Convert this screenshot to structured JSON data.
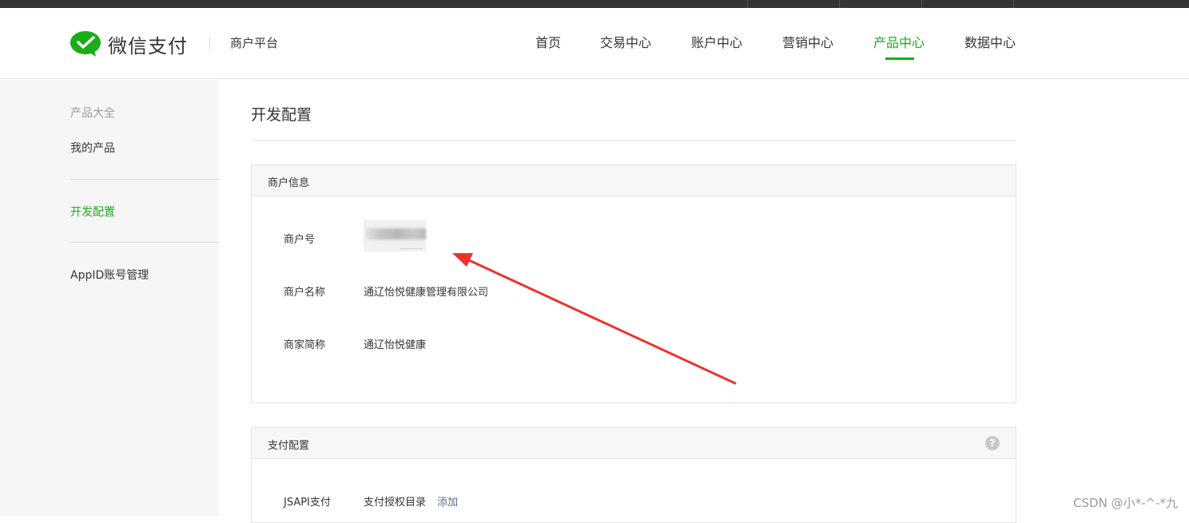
{
  "brand": {
    "name": "微信支付",
    "platform": "商户平台"
  },
  "nav": {
    "items": [
      {
        "label": "首页"
      },
      {
        "label": "交易中心"
      },
      {
        "label": "账户中心"
      },
      {
        "label": "营销中心"
      },
      {
        "label": "产品中心",
        "active": true
      },
      {
        "label": "数据中心"
      }
    ]
  },
  "sidebar": {
    "items": [
      {
        "label": "产品大全"
      },
      {
        "label": "我的产品"
      },
      {
        "label": "开发配置",
        "active": true
      },
      {
        "label": "AppID账号管理"
      }
    ]
  },
  "main": {
    "title": "开发配置",
    "merchant_panel": {
      "title": "商户信息",
      "rows": [
        {
          "label": "商户号",
          "value": ""
        },
        {
          "label": "商户名称",
          "value": "通辽怡悦健康管理有限公司"
        },
        {
          "label": "商家简称",
          "value": "通辽怡悦健康"
        }
      ]
    },
    "pay_panel": {
      "title": "支付配置",
      "help_icon": "question-icon",
      "row": {
        "label": "JSAPI支付",
        "value": "支付授权目录",
        "action": "添加"
      }
    }
  },
  "watermark": "CSDN @小*-^-*九",
  "colors": {
    "accent": "#1aad19",
    "link": "#576b95",
    "annotation_arrow": "#f0302b"
  }
}
